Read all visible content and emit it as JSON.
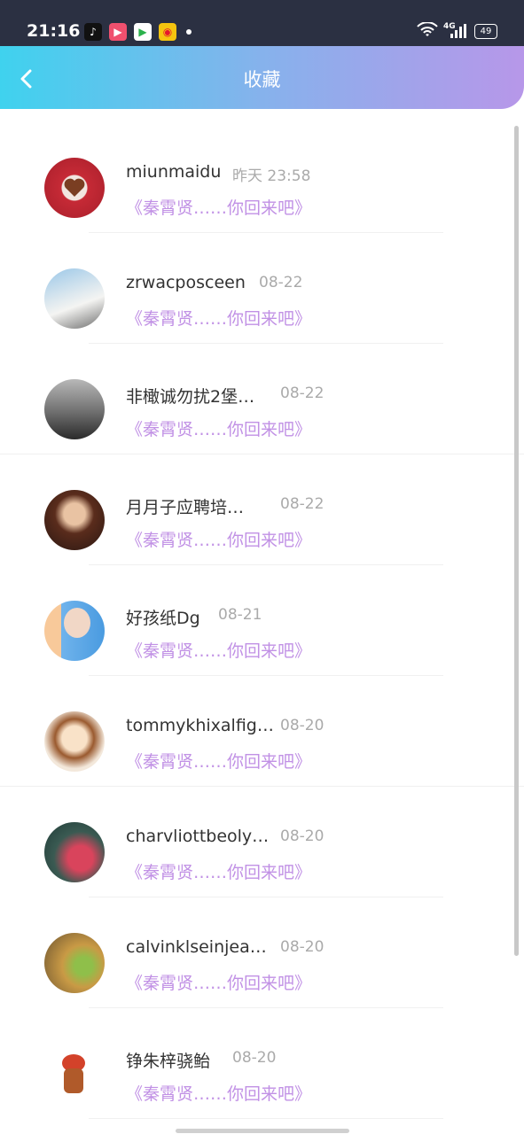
{
  "status": {
    "time": "21:16",
    "network": "4G",
    "battery": "49"
  },
  "header": {
    "title": "收藏"
  },
  "colors": {
    "accent": "#c191e5",
    "gradient_start": "#3fd2ee",
    "gradient_end": "#b797e9"
  },
  "favorites": [
    {
      "name": "miunmaidu",
      "date": "昨天 23:58",
      "title": "《秦霄贤……你回来吧》"
    },
    {
      "name": "zrwacposceen",
      "date": "08-22",
      "title": "《秦霄贤……你回来吧》"
    },
    {
      "name": "非橄诚勿扰2堡…",
      "date": "08-22",
      "title": "《秦霄贤……你回来吧》"
    },
    {
      "name": "月月子应聘培…",
      "date": "08-22",
      "title": "《秦霄贤……你回来吧》"
    },
    {
      "name": "好孩纸Dg",
      "date": "08-21",
      "title": "《秦霄贤……你回来吧》"
    },
    {
      "name": "tommykhixalfig…",
      "date": "08-20",
      "title": "《秦霄贤……你回来吧》"
    },
    {
      "name": "charvliottbeoly…",
      "date": "08-20",
      "title": "《秦霄贤……你回来吧》"
    },
    {
      "name": "calvinklseinjea…",
      "date": "08-20",
      "title": "《秦霄贤……你回来吧》"
    },
    {
      "name": "铮朱梓骁鲐",
      "date": "08-20",
      "title": "《秦霄贤……你回来吧》"
    }
  ]
}
